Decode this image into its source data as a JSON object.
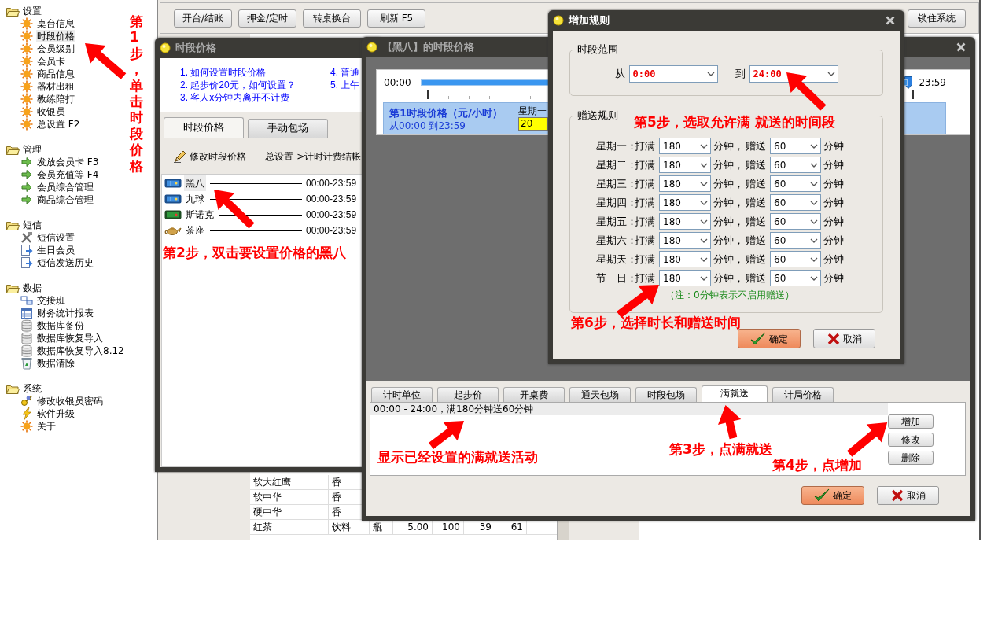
{
  "sidebar": {
    "groups": [
      {
        "label": "设置",
        "items": [
          {
            "label": "桌台信息",
            "kind": "sun",
            "selected": false
          },
          {
            "label": "时段价格",
            "kind": "sun",
            "selected": true
          },
          {
            "label": "会员级别",
            "kind": "sun",
            "selected": false
          },
          {
            "label": "会员卡",
            "kind": "sun",
            "selected": false
          },
          {
            "label": "商品信息",
            "kind": "sun",
            "selected": false
          },
          {
            "label": "器材出租",
            "kind": "sun",
            "selected": false
          },
          {
            "label": "教练陪打",
            "kind": "sun",
            "selected": false
          },
          {
            "label": "收银员",
            "kind": "sun",
            "selected": false
          },
          {
            "label": "总设置 F2",
            "kind": "sun",
            "selected": false
          }
        ]
      },
      {
        "label": "管理",
        "items": [
          {
            "label": "发放会员卡 F3",
            "kind": "arrow",
            "selected": false
          },
          {
            "label": "会员充值等 F4",
            "kind": "arrow",
            "selected": false
          },
          {
            "label": "会员综合管理",
            "kind": "arrow",
            "selected": false
          },
          {
            "label": "商品综合管理",
            "kind": "arrow",
            "selected": false
          }
        ]
      },
      {
        "label": "短信",
        "items": [
          {
            "label": "短信设置",
            "kind": "tools",
            "selected": false
          },
          {
            "label": "生日会员",
            "kind": "message",
            "selected": false
          },
          {
            "label": "短信发送历史",
            "kind": "message",
            "selected": false
          }
        ]
      },
      {
        "label": "数据",
        "items": [
          {
            "label": "交接班",
            "kind": "swap",
            "selected": false
          },
          {
            "label": "财务统计报表",
            "kind": "grid",
            "selected": false
          },
          {
            "label": "数据库备份",
            "kind": "database",
            "selected": false
          },
          {
            "label": "数据库恢复导入",
            "kind": "database",
            "selected": false
          },
          {
            "label": "数据库恢复导入8.12",
            "kind": "database",
            "selected": false
          },
          {
            "label": "数据清除",
            "kind": "recycle",
            "selected": false
          }
        ]
      },
      {
        "label": "系统",
        "items": [
          {
            "label": "修改收银员密码",
            "kind": "key",
            "selected": false
          },
          {
            "label": "软件升级",
            "kind": "lightning",
            "selected": false
          },
          {
            "label": "关于",
            "kind": "sun",
            "selected": false
          }
        ]
      }
    ],
    "annotation": "第1步，单击时段价格"
  },
  "toolbar": {
    "buttons": [
      "开台/结账",
      "押金/定时",
      "转桌换台",
      "刷新 F5"
    ],
    "lock_button": "锁住系统"
  },
  "product_table": {
    "rows": [
      [
        "软大红鹰",
        "香"
      ],
      [
        "软中华",
        "香"
      ],
      [
        "硬中华",
        "香"
      ],
      [
        "红茶",
        "饮料",
        "瓶",
        "5.00",
        "100",
        "39",
        "61"
      ]
    ]
  },
  "price_window": {
    "title": "时段价格",
    "help_links": [
      [
        "1. 如何设置时段价格",
        "2. 起步价20元，如何设置？",
        "3. 客人x分钟内离开不计费"
      ],
      [
        "4. 普通",
        "5. 上午"
      ]
    ],
    "tabs": [
      {
        "label": "时段价格",
        "selected": true
      },
      {
        "label": "手动包场",
        "selected": false
      }
    ],
    "edit_action": "修改时段价格",
    "settings_link": "总设置->计时计费结帐",
    "tables": [
      {
        "name": "黑八",
        "kind": "pool",
        "time": "00:00-23:59",
        "selected": true
      },
      {
        "name": "九球",
        "kind": "pool",
        "time": "00:00-23:59",
        "selected": false
      },
      {
        "name": "斯诺克",
        "kind": "snooker",
        "time": "00:00-23:59",
        "selected": false
      },
      {
        "name": "茶座",
        "kind": "teapot",
        "time": "00:00-23:59",
        "selected": false
      }
    ],
    "annotation": "第2步，双击要设置价格的黑八"
  },
  "detail_window": {
    "title": "【黑八】的时段价格",
    "timeline": {
      "start": "00:00",
      "end": "23:59",
      "segment_title": "第1时段价格（元/小时）",
      "segment_range": "从00:00 到23:59",
      "day": "星期一",
      "price": "20"
    },
    "tabs": [
      {
        "label": "计时单位",
        "selected": false
      },
      {
        "label": "起步价",
        "selected": false
      },
      {
        "label": "开桌费",
        "selected": false
      },
      {
        "label": "通天包场",
        "selected": false
      },
      {
        "label": "时段包场",
        "selected": false
      },
      {
        "label": "满就送",
        "selected": true
      },
      {
        "label": "计局价格",
        "selected": false
      }
    ],
    "rules": [
      "00:00 - 24:00，满180分钟送60分钟"
    ],
    "side_buttons": [
      "增加",
      "修改",
      "删除"
    ],
    "ok": "确定",
    "cancel": "取消",
    "annotations": [
      "显示已经设置的满就送活动",
      "第3步，点满就送",
      "第4步，点增加"
    ]
  },
  "rule_dialog": {
    "title": "增加规则",
    "range_legend": "时段范围",
    "from_label": "从",
    "from": "0:00",
    "to_label": "到",
    "to": "24:00",
    "bonus_legend": "赠送规则",
    "days": [
      {
        "day": "星期一：",
        "reach": "打满",
        "minutes": "180",
        "unit": "分钟，",
        "give": "赠送",
        "bonus": "60",
        "bonus_unit": "分钟"
      },
      {
        "day": "星期二：",
        "reach": "打满",
        "minutes": "180",
        "unit": "分钟，",
        "give": "赠送",
        "bonus": "60",
        "bonus_unit": "分钟"
      },
      {
        "day": "星期三：",
        "reach": "打满",
        "minutes": "180",
        "unit": "分钟，",
        "give": "赠送",
        "bonus": "60",
        "bonus_unit": "分钟"
      },
      {
        "day": "星期四：",
        "reach": "打满",
        "minutes": "180",
        "unit": "分钟，",
        "give": "赠送",
        "bonus": "60",
        "bonus_unit": "分钟"
      },
      {
        "day": "星期五：",
        "reach": "打满",
        "minutes": "180",
        "unit": "分钟，",
        "give": "赠送",
        "bonus": "60",
        "bonus_unit": "分钟"
      },
      {
        "day": "星期六：",
        "reach": "打满",
        "minutes": "180",
        "unit": "分钟，",
        "give": "赠送",
        "bonus": "60",
        "bonus_unit": "分钟"
      },
      {
        "day": "星期天：",
        "reach": "打满",
        "minutes": "180",
        "unit": "分钟，",
        "give": "赠送",
        "bonus": "60",
        "bonus_unit": "分钟"
      },
      {
        "day": "节　日：",
        "reach": "打满",
        "minutes": "180",
        "unit": "分钟，",
        "give": "赠送",
        "bonus": "60",
        "bonus_unit": "分钟"
      }
    ],
    "note": "（注：0分钟表示不启用赠送）",
    "ok": "确定",
    "cancel": "取消",
    "annotations": [
      "第5步，选取允许满 就送的时间段",
      "第6步，选择时长和赠送时间"
    ]
  }
}
